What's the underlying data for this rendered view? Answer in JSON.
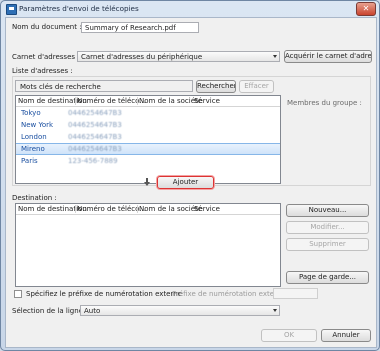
{
  "window": {
    "title": "Paramètres d'envoi de télécopies",
    "close_glyph": "✕"
  },
  "document": {
    "label": "Nom du document :",
    "value": "Summary of Research.pdf"
  },
  "address_book": {
    "label": "Carnet d'adresses :",
    "selected": "Carnet d'adresses du périphérique",
    "acquire_label": "Acquérir le carnet d'adresses"
  },
  "address_list": {
    "label": "Liste d'adresses :",
    "search_label": "Mots clés de recherche",
    "search_value": "",
    "search_button": "Rechercher",
    "clear_button": "Effacer",
    "columns": [
      "Nom de destination",
      "Numéro de téléco...",
      "Nom de la société",
      "Service"
    ],
    "rows": [
      {
        "name": "Tokyo",
        "number": "0446254647B3"
      },
      {
        "name": "New York",
        "number": "0446254647B3"
      },
      {
        "name": "London",
        "number": "0446254647B3"
      },
      {
        "name": "Mireno",
        "number": "0446254647B3",
        "selected": true
      },
      {
        "name": "Paris",
        "number": "123-456-7889"
      }
    ],
    "group_members_label": "Membres du groupe :"
  },
  "add_button": "Ajouter",
  "destination": {
    "label": "Destination :",
    "columns": [
      "Nom de destination",
      "Numéro de téléco...",
      "Nom de la société",
      "Service"
    ],
    "new_button": "Nouveau...",
    "edit_button": "Modifier...",
    "delete_button": "Supprimer",
    "cover_button": "Page de garde..."
  },
  "prefix": {
    "checkbox_label": "Spécifiez le préfixe de numérotation externe",
    "field_label": "Préfixe de numérotation externe :",
    "value": ""
  },
  "line": {
    "label": "Sélection de la ligne :",
    "selected": "Auto"
  },
  "ok_button": "OK",
  "cancel_button": "Annuler",
  "colors": {
    "accent": "#1a4fa0",
    "focus_ring": "#dd3333"
  }
}
